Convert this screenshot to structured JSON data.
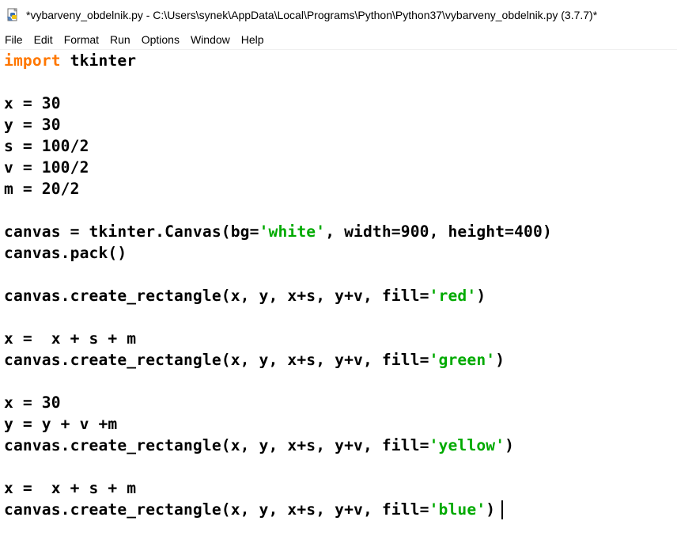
{
  "window": {
    "title": "*vybarveny_obdelnik.py - C:\\Users\\synek\\AppData\\Local\\Programs\\Python\\Python37\\vybarveny_obdelnik.py (3.7.7)*",
    "icon": "python-file-icon"
  },
  "menu": [
    "File",
    "Edit",
    "Format",
    "Run",
    "Options",
    "Window",
    "Help"
  ],
  "colors": {
    "keyword": "#ff7700",
    "string": "#00aa00",
    "text": "#000000",
    "background": "#ffffff"
  },
  "code": [
    [
      {
        "t": "import",
        "c": "kw"
      },
      {
        "t": " tkinter"
      }
    ],
    [],
    [
      {
        "t": "x = 30"
      }
    ],
    [
      {
        "t": "y = 30"
      }
    ],
    [
      {
        "t": "s = 100/2"
      }
    ],
    [
      {
        "t": "v = 100/2"
      }
    ],
    [
      {
        "t": "m = 20/2"
      }
    ],
    [],
    [
      {
        "t": "canvas = tkinter.Canvas(bg="
      },
      {
        "t": "'white'",
        "c": "str"
      },
      {
        "t": ", width=900, height=400)"
      }
    ],
    [
      {
        "t": "canvas.pack()"
      }
    ],
    [],
    [
      {
        "t": "canvas.create_rectangle(x, y, x+s, y+v, fill="
      },
      {
        "t": "'red'",
        "c": "str"
      },
      {
        "t": ")"
      }
    ],
    [],
    [
      {
        "t": "x =  x + s + m"
      }
    ],
    [
      {
        "t": "canvas.create_rectangle(x, y, x+s, y+v, fill="
      },
      {
        "t": "'green'",
        "c": "str"
      },
      {
        "t": ")"
      }
    ],
    [],
    [
      {
        "t": "x = 30"
      }
    ],
    [
      {
        "t": "y = y + v +m"
      }
    ],
    [
      {
        "t": "canvas.create_rectangle(x, y, x+s, y+v, fill="
      },
      {
        "t": "'yellow'",
        "c": "str"
      },
      {
        "t": ")"
      }
    ],
    [],
    [
      {
        "t": "x =  x + s + m"
      }
    ],
    [
      {
        "t": "canvas.create_rectangle(x, y, x+s, y+v, fill="
      },
      {
        "t": "'blue'",
        "c": "str"
      },
      {
        "t": ")"
      }
    ]
  ],
  "cursor_line": 21
}
